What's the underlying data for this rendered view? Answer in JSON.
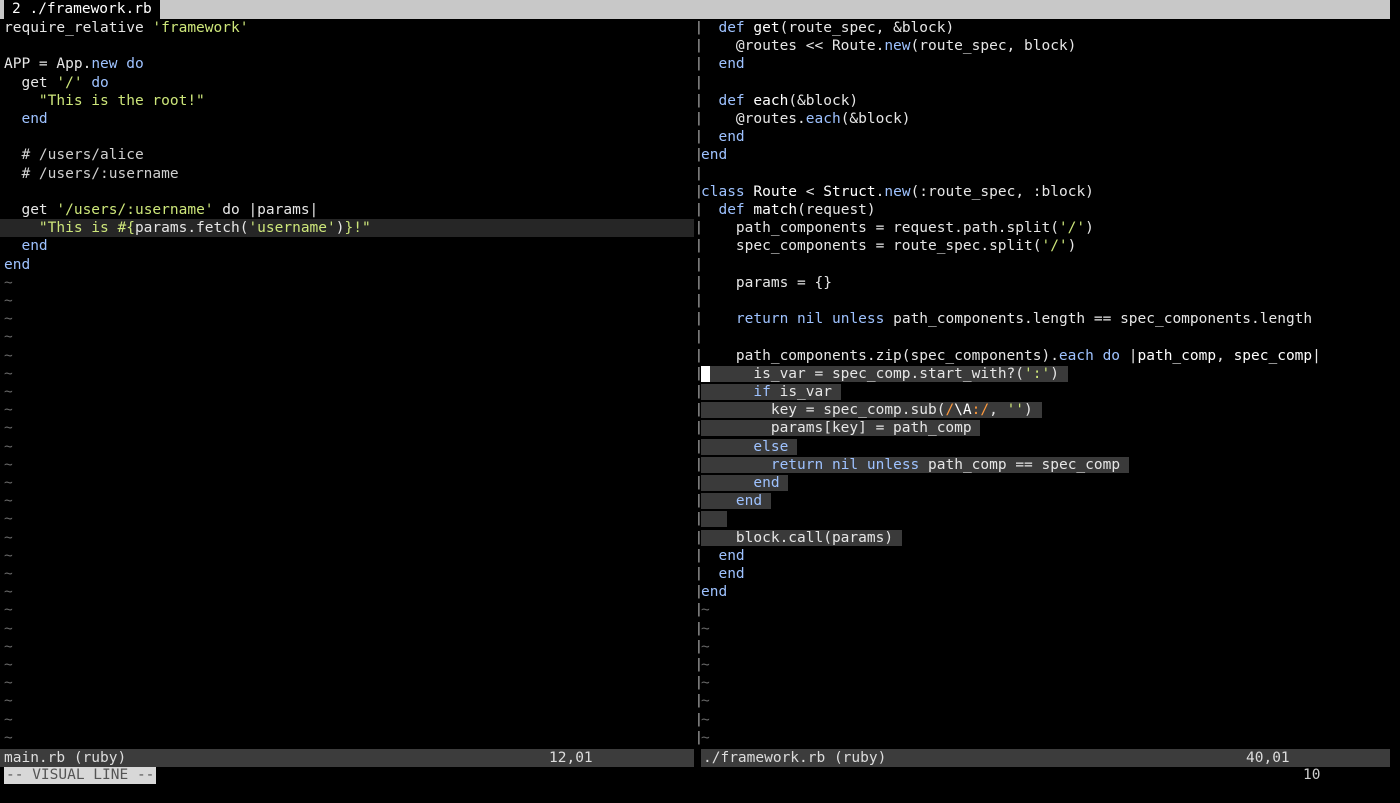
{
  "tabline": {
    "tab_label": "2 ./framework.rb"
  },
  "left_pane": {
    "lines": [
      [
        {
          "t": "require_relative ",
          "c": ""
        },
        {
          "t": "'framework'",
          "c": "str"
        }
      ],
      [],
      [
        {
          "t": "APP = App.",
          "c": ""
        },
        {
          "t": "new",
          "c": "kw"
        },
        {
          "t": " ",
          "c": ""
        },
        {
          "t": "do",
          "c": "kw"
        }
      ],
      [
        {
          "t": "  get ",
          "c": ""
        },
        {
          "t": "'/'",
          "c": "str"
        },
        {
          "t": " ",
          "c": ""
        },
        {
          "t": "do",
          "c": "kw"
        }
      ],
      [
        {
          "t": "    ",
          "c": ""
        },
        {
          "t": "\"This is the root!\"",
          "c": "str"
        }
      ],
      [
        {
          "t": "  end",
          "c": "kw"
        }
      ],
      [],
      [
        {
          "t": "  # /users/alice",
          "c": "cmt"
        }
      ],
      [
        {
          "t": "  # /users/:username",
          "c": "cmt"
        }
      ],
      [],
      [
        {
          "t": "  get ",
          "c": ""
        },
        {
          "t": "'/users/:username'",
          "c": "str"
        },
        {
          "t": " do |params|",
          "c": ""
        }
      ],
      [
        {
          "t": "    ",
          "c": ""
        },
        {
          "t": "\"This is #{",
          "c": "str"
        },
        {
          "t": "params.fetch(",
          "c": ""
        },
        {
          "t": "'username'",
          "c": "str"
        },
        {
          "t": ")",
          "c": ""
        },
        {
          "t": "}!\"",
          "c": "str"
        }
      ],
      [
        {
          "t": "  end",
          "c": "kw"
        }
      ],
      [
        {
          "t": "end",
          "c": "kw"
        }
      ]
    ],
    "current_line": 11,
    "empty_marker": "~",
    "empty_count": 26
  },
  "right_pane": {
    "lines": [
      [
        {
          "t": "  ",
          "c": ""
        },
        {
          "t": "def",
          "c": "kw"
        },
        {
          "t": " ",
          "c": ""
        },
        {
          "t": "get",
          "c": "fn"
        },
        {
          "t": "(route_spec, &block)",
          "c": ""
        }
      ],
      [
        {
          "t": "    @routes << Route.",
          "c": ""
        },
        {
          "t": "new",
          "c": "kw"
        },
        {
          "t": "(route_spec, block)",
          "c": ""
        }
      ],
      [
        {
          "t": "  end",
          "c": "kw"
        }
      ],
      [],
      [
        {
          "t": "  ",
          "c": ""
        },
        {
          "t": "def",
          "c": "kw"
        },
        {
          "t": " ",
          "c": ""
        },
        {
          "t": "each",
          "c": "fn"
        },
        {
          "t": "(&block)",
          "c": ""
        }
      ],
      [
        {
          "t": "    @routes.",
          "c": ""
        },
        {
          "t": "each",
          "c": "kw"
        },
        {
          "t": "(&block)",
          "c": ""
        }
      ],
      [
        {
          "t": "  end",
          "c": "kw"
        }
      ],
      [
        {
          "t": "end",
          "c": "kw"
        }
      ],
      [],
      [
        {
          "t": "class",
          "c": "kw"
        },
        {
          "t": " ",
          "c": ""
        },
        {
          "t": "Route",
          "c": "fn"
        },
        {
          "t": " < ",
          "c": ""
        },
        {
          "t": "Struct",
          "c": "fn"
        },
        {
          "t": ".",
          "c": ""
        },
        {
          "t": "new",
          "c": "kw"
        },
        {
          "t": "(:route_spec, :block)",
          "c": ""
        }
      ],
      [
        {
          "t": "  ",
          "c": ""
        },
        {
          "t": "def",
          "c": "kw"
        },
        {
          "t": " ",
          "c": ""
        },
        {
          "t": "match",
          "c": "fn"
        },
        {
          "t": "(request)",
          "c": ""
        }
      ],
      [
        {
          "t": "    path_components = request.path.split(",
          "c": ""
        },
        {
          "t": "'/'",
          "c": "str"
        },
        {
          "t": ")",
          "c": ""
        }
      ],
      [
        {
          "t": "    spec_components = route_spec.split(",
          "c": ""
        },
        {
          "t": "'/'",
          "c": "str"
        },
        {
          "t": ")",
          "c": ""
        }
      ],
      [],
      [
        {
          "t": "    params = {}",
          "c": ""
        }
      ],
      [],
      [
        {
          "t": "    ",
          "c": ""
        },
        {
          "t": "return",
          "c": "kw"
        },
        {
          "t": " ",
          "c": ""
        },
        {
          "t": "nil",
          "c": "kw"
        },
        {
          "t": " ",
          "c": ""
        },
        {
          "t": "unless",
          "c": "kw"
        },
        {
          "t": " path_components.length == spec_components.length",
          "c": ""
        }
      ],
      [],
      [
        {
          "t": "    path_components.zip(spec_components).",
          "c": ""
        },
        {
          "t": "each",
          "c": "kw"
        },
        {
          "t": " ",
          "c": ""
        },
        {
          "t": "do",
          "c": "kw"
        },
        {
          "t": " |",
          "c": ""
        },
        {
          "t": "path_comp",
          "c": "fn"
        },
        {
          "t": ", ",
          "c": ""
        },
        {
          "t": "spec_comp",
          "c": "fn"
        },
        {
          "t": "|",
          "c": ""
        }
      ],
      [
        {
          "t": " ",
          "c": "cursorblk"
        },
        {
          "t": "     is_var = spec_comp.start_with?(",
          "c": ""
        },
        {
          "t": "':'",
          "c": "str"
        },
        {
          "t": ")",
          "c": ""
        }
      ],
      [
        {
          "t": "      ",
          "c": ""
        },
        {
          "t": "if",
          "c": "kw"
        },
        {
          "t": " is_var",
          "c": ""
        }
      ],
      [
        {
          "t": "        key = spec_comp.sub(",
          "c": ""
        },
        {
          "t": "/",
          "c": "re"
        },
        {
          "t": "\\A",
          "c": "fn"
        },
        {
          "t": ":/",
          "c": "re"
        },
        {
          "t": ", ",
          "c": ""
        },
        {
          "t": "''",
          "c": "str"
        },
        {
          "t": ")",
          "c": ""
        }
      ],
      [
        {
          "t": "        params[key] = path_comp",
          "c": ""
        }
      ],
      [
        {
          "t": "      ",
          "c": ""
        },
        {
          "t": "else",
          "c": "kw"
        }
      ],
      [
        {
          "t": "        ",
          "c": ""
        },
        {
          "t": "return",
          "c": "kw"
        },
        {
          "t": " ",
          "c": ""
        },
        {
          "t": "nil",
          "c": "kw"
        },
        {
          "t": " ",
          "c": ""
        },
        {
          "t": "unless",
          "c": "kw"
        },
        {
          "t": " path_comp == spec_comp",
          "c": ""
        }
      ],
      [
        {
          "t": "      end",
          "c": "kw"
        }
      ],
      [
        {
          "t": "    end",
          "c": "kw"
        }
      ],
      [
        {
          "t": "  ",
          "c": ""
        }
      ],
      [
        {
          "t": "    block.call(params)",
          "c": ""
        }
      ],
      [
        {
          "t": "  end",
          "c": "kw"
        }
      ],
      [
        {
          "t": "  end",
          "c": "kw"
        }
      ],
      [
        {
          "t": "end",
          "c": "kw"
        }
      ]
    ],
    "selection_start": 19,
    "selection_end": 28,
    "empty_marker": "~",
    "empty_count": 8
  },
  "status_left": {
    "file_label": "main.rb (ruby)",
    "position": "12,01"
  },
  "status_right": {
    "file_label": "./framework.rb (ruby)",
    "position": "40,01"
  },
  "command_line": {
    "mode": "-- VISUAL LINE --",
    "selected_count": "10"
  }
}
